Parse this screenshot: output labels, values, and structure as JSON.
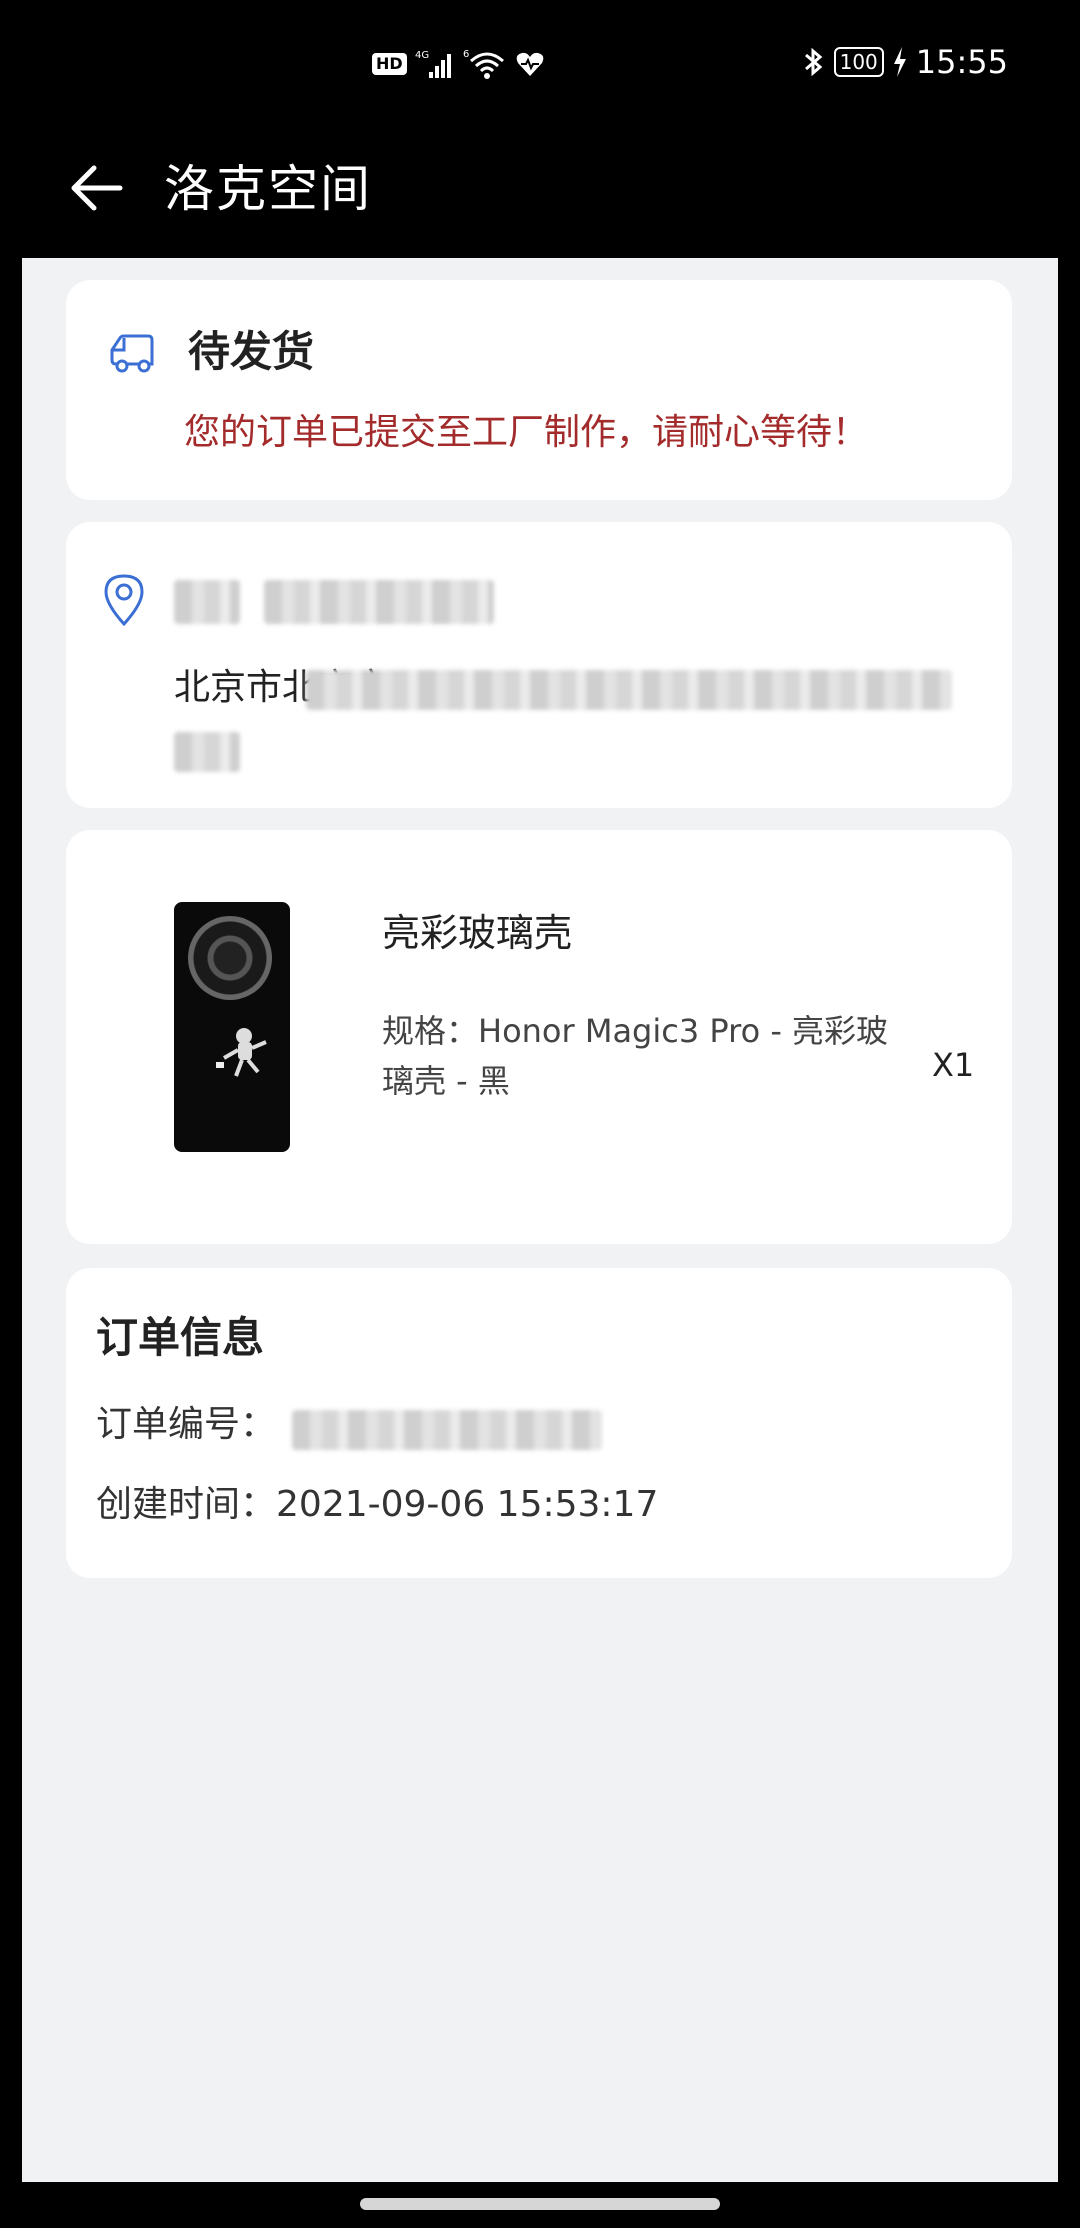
{
  "status_bar": {
    "network_badge": "HD",
    "network_type": "4G",
    "wifi_badge": "6",
    "battery": "100",
    "time": "15:55"
  },
  "app_bar": {
    "title": "洛克空间",
    "back_icon": "arrow-left-icon"
  },
  "order_status": {
    "icon": "truck-icon",
    "title": "待发货",
    "message": "您的订单已提交至工厂制作，请耐心等待！"
  },
  "address": {
    "icon": "location-pin-icon",
    "city_prefix": "北京市北京市"
  },
  "product": {
    "name": "亮彩玻璃壳",
    "spec": "规格：Honor Magic3 Pro - 亮彩玻璃壳 - 黑",
    "quantity": "X1"
  },
  "order_info": {
    "title": "订单信息",
    "order_no_label": "订单编号：",
    "created_time_label": "创建时间：",
    "created_time": "2021-09-06 15:53:17"
  },
  "colors": {
    "message_red": "#a32b2b",
    "icon_blue": "#3b6fd4",
    "background": "#f1f2f4"
  }
}
